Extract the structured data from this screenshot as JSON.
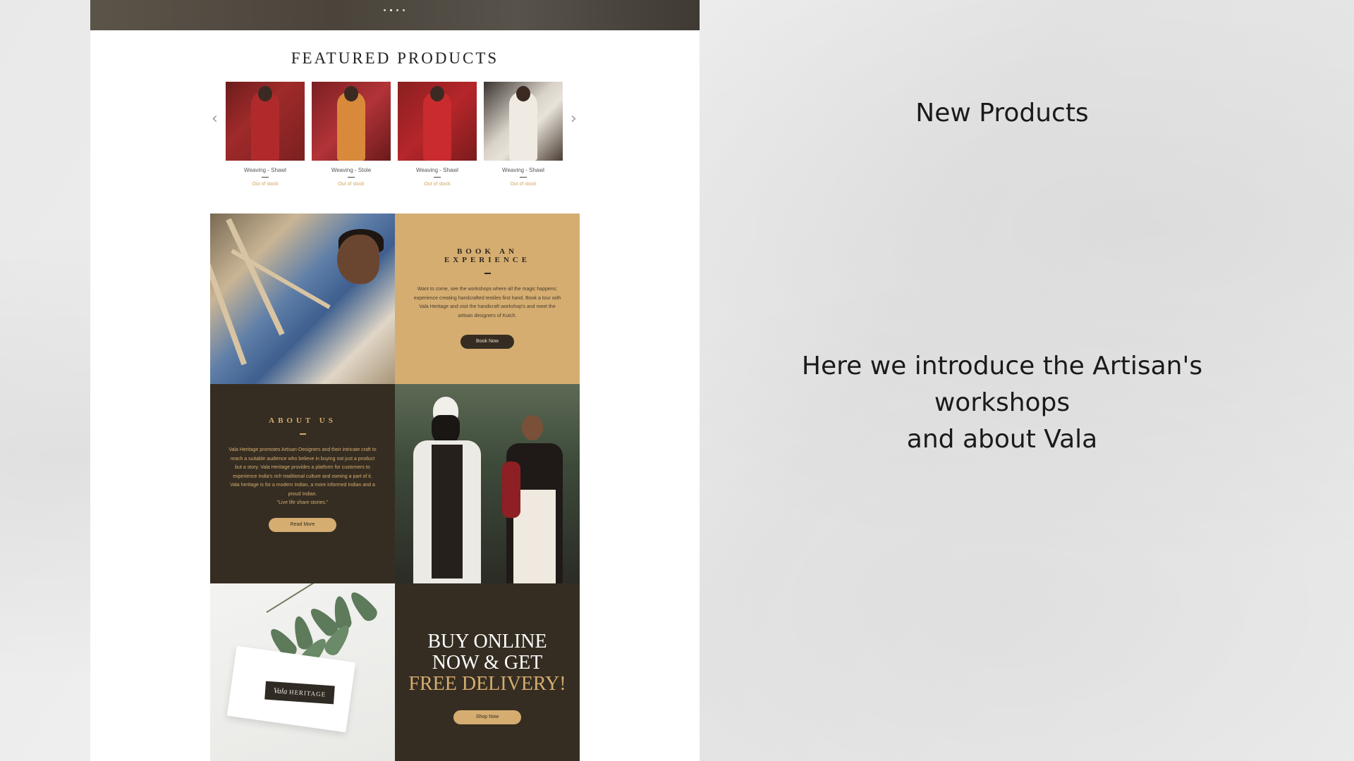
{
  "carousel": {
    "dot_count": 4
  },
  "featured": {
    "title": "FEATURED PRODUCTS",
    "prev_icon": "chevron-left-icon",
    "next_icon": "chevron-right-icon",
    "products": [
      {
        "name": "Weaving - Shawl",
        "stock": "Out of stock"
      },
      {
        "name": "Weaving - Stole",
        "stock": "Out of stock"
      },
      {
        "name": "Weaving - Shawl",
        "stock": "Out of stock"
      },
      {
        "name": "Weaving - Shawl",
        "stock": "Out of stock"
      }
    ]
  },
  "book": {
    "heading_line1": "BOOK AN",
    "heading_line2": "EXPERIENCE",
    "text": "Want to come, see the workshops where all the magic happens; experience creating handcrafted textiles first hand. Book a tour with Vala Heritage and visit the handicraft workshop's and meet the artisan designers of Kutch.",
    "button": "Book Now"
  },
  "about": {
    "heading": "ABOUT US",
    "text": "Vala Heritage promotes Artisan-Designers and their intricate craft to reach a suitable audience who believe in buying not just a product but a story. Vala Heritage provides a platform for customers to experience India's rich traditional culture and owning a part of it. Vala heritage is for a modern Indian, a more informed Indian and a proud Indian.",
    "quote": "\"Live life share stories.\"",
    "button": "Read More"
  },
  "brand_card": {
    "script": "Vala",
    "caps": "HERITAGE"
  },
  "buy": {
    "line1": "BUY ONLINE",
    "line2": "NOW & GET",
    "line3": "FREE DELIVERY!",
    "button": "Shop Now"
  },
  "captions": {
    "new_products": "New Products",
    "intro_line1": "Here we introduce the Artisan's workshops",
    "intro_line2": "and about Vala"
  },
  "colors": {
    "gold": "#d5ad70",
    "dark_brown": "#352d22",
    "stock_text": "#d4a35c"
  }
}
